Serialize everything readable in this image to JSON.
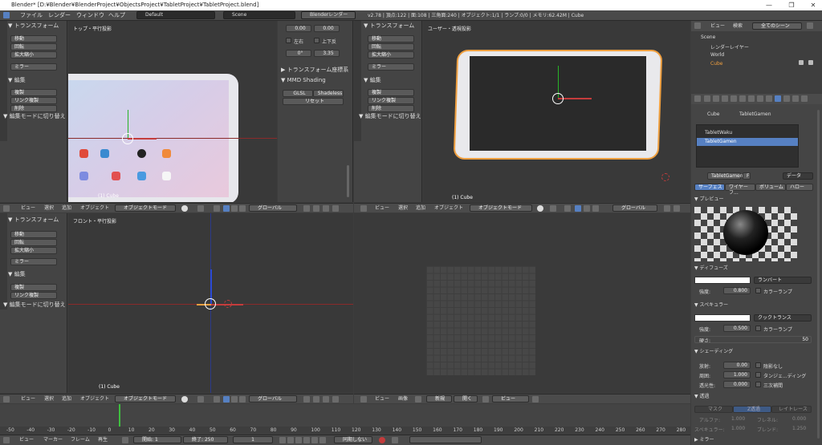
{
  "window": {
    "title": "Blender* [D:¥Blender¥BlenderProject¥ObjectsProject¥TabletProject¥TabletProject.blend]",
    "min": "—",
    "max": "❐",
    "close": "✕"
  },
  "menubar": {
    "file": "ファイル",
    "render": "レンダー",
    "window": "ウィンドウ",
    "help": "ヘルプ",
    "layout": "Default",
    "scene": "Scene",
    "engine": "Blenderレンダー",
    "stats": "v2.78 | 頂点:122 | 面:108 | 三角面:240 | オブジェクト:1/1 | ランプ:0/0 | メモリ:62.42M | Cube"
  },
  "tool_panel": {
    "transform": "▼ トランスフォーム",
    "move": "移動",
    "rotate": "回転",
    "scale": "拡大縮小",
    "mirror": "ミラー",
    "edit": "▼ 編集",
    "duplicate": "複製",
    "link_dup": "リンク複製",
    "delete": "削除",
    "editmode": "▼ 編集モードに切り替え",
    "tabs": "ツール 作成 関係 アニメ 物理"
  },
  "props_panel": {
    "v1": "0.00",
    "v2": "0.00",
    "left": "左右",
    "updown": "上下反",
    "v3": "0°",
    "v4": "3.35",
    "transform_coord": "▶ トランスフォーム座標系",
    "mmd": "▼ MMD Shading",
    "glsl": "GLSL",
    "shadeless": "Shadeless",
    "reset": "リセット"
  },
  "viewports": {
    "top": "トップ・平行投影",
    "user": "ユーザー・透視投影",
    "front": "フロント・平行投影",
    "cube1": "(1) Cube",
    "cube2": "(1) Cube",
    "cube3": "(1) Cube"
  },
  "header": {
    "view": "ビュー",
    "select": "選択",
    "add": "追加",
    "object": "オブジェクト",
    "mode": "オブジェクトモード",
    "global": "グローバル",
    "image": "画像",
    "new": "新規",
    "open": "開く",
    "view2": "ビュー"
  },
  "outliner": {
    "view": "ビュー",
    "search": "検索",
    "all_scenes": "全てのシーン",
    "scene": "Scene",
    "render_layer": "レンダーレイヤー",
    "world": "World",
    "cube": "Cube"
  },
  "material": {
    "cube": "Cube",
    "mat": "TabletGamen",
    "slot1": "TabletWaku",
    "slot2": "TabletGamen",
    "name": "TabletGamen",
    "f": "F",
    "data": "データ",
    "tab_surface": "サーフェス",
    "tab_wire": "ワイヤーフ...",
    "tab_volume": "ボリューム",
    "tab_halo": "ハロー",
    "preview": "▼ プレビュー",
    "diffuse": "▼ ディフューズ",
    "lambert": "ランバート",
    "intensity_label": "強度:",
    "diffuse_int": "0.800",
    "ramp": "カラーランプ",
    "specular": "▼ スペキュラー",
    "cooktorr": "クックトランス",
    "spec_int": "0.500",
    "ramp2": "カラーランプ",
    "hardness_label": "硬さ:",
    "hardness": "50",
    "shading": "▼ シェーディング",
    "emit_label": "放射:",
    "emit": "0.00",
    "shadeless": "陰影なし",
    "ambient_label": "周囲:",
    "ambient": "1.000",
    "tangent": "タンジェ...ディング",
    "translucency_label": "透光性:",
    "translucency": "0.000",
    "cubic": "三次補間",
    "transparency": "▼ 透過",
    "mask": "マスク",
    "ztrans": "Z透過",
    "raytrace": "レイトレース",
    "alpha_label": "アルファ:",
    "alpha": "1.000",
    "fresnel_label": "フレネル:",
    "fresnel": "0.000",
    "specular2_label": "スペキュラー:",
    "specular2": "1.000",
    "blend_label": "ブレンド:",
    "blend": "1.250",
    "mirror": "▶ ミラー"
  },
  "timeline": {
    "ticks": [
      "-50",
      "-40",
      "-30",
      "-20",
      "-10",
      "0",
      "10",
      "20",
      "30",
      "40",
      "50",
      "60",
      "70",
      "80",
      "90",
      "100",
      "110",
      "120",
      "130",
      "140",
      "150",
      "160",
      "170",
      "180",
      "190",
      "200",
      "210",
      "220",
      "230",
      "240",
      "250",
      "260",
      "270",
      "280"
    ],
    "view": "ビュー",
    "marker": "マーカー",
    "frame": "フレーム",
    "playback": "再生",
    "start_label": "開始:",
    "start": "1",
    "end_label": "終了:",
    "end": "250",
    "current": "1",
    "sync": "同期しない"
  },
  "colors": {
    "accent": "#5680c2",
    "axis_x": "#c43c3c",
    "axis_y": "#27b327",
    "axis_z": "#2b4ad6",
    "select": "#f0a040"
  }
}
